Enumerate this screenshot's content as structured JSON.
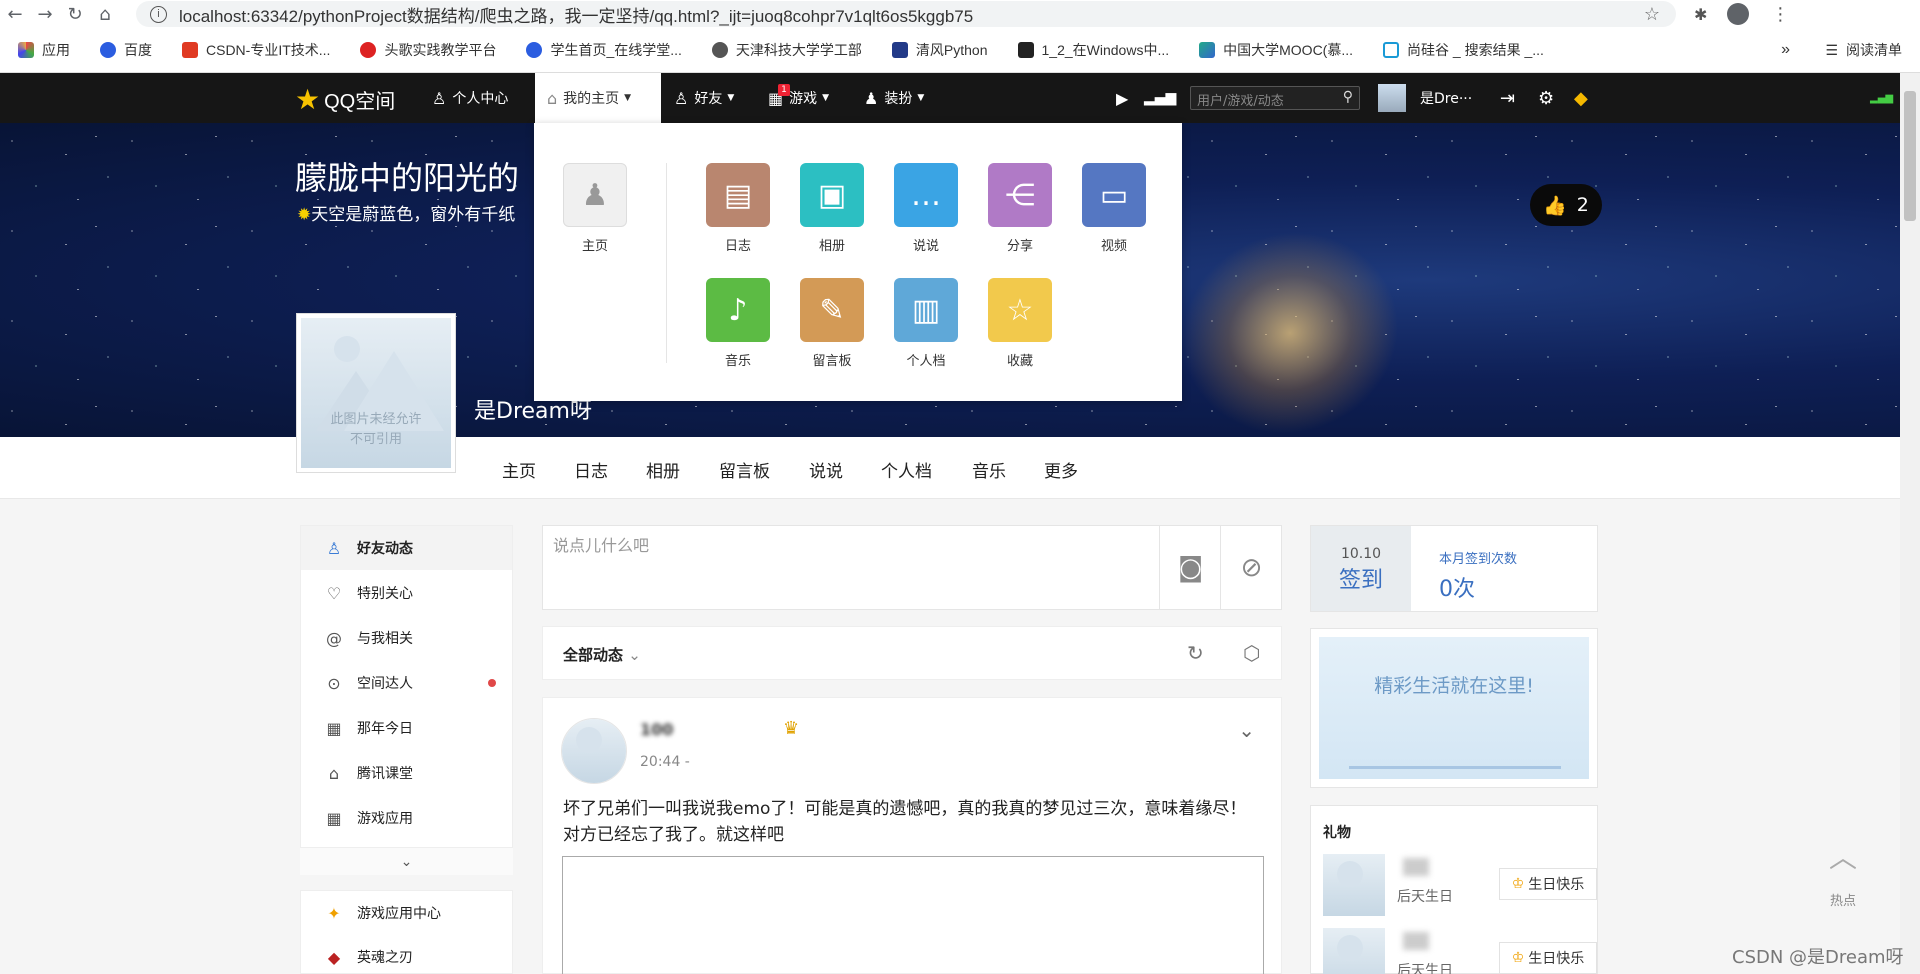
{
  "browser": {
    "url": "localhost:63342/pythonProject数据结构/爬虫之路，我一定坚持/qq.html?_ijt=juoq8cohpr7v1qlt6os5kggb75",
    "bookmarks": [
      "应用",
      "百度",
      "CSDN-专业IT技术...",
      "头歌实践教学平台",
      "学生首页_在线学堂...",
      "天津科技大学学工部",
      "清风Python",
      "1_2_在Windows中...",
      "中国大学MOOC(慕...",
      "尚硅谷 _ 搜索结果 _..."
    ],
    "reading_list": "阅读清单"
  },
  "topbar": {
    "logo": "QQ空间",
    "nav": [
      "个人中心",
      "我的主页",
      "好友",
      "游戏",
      "装扮"
    ],
    "game_badge": "1",
    "search_placeholder": "用户/游戏/动态",
    "user": "是Dre···"
  },
  "banner": {
    "title": "朦胧中的阳光的",
    "subtitle": "天空是蔚蓝色，窗外有千纸",
    "likes": "2",
    "username": "是Dream呀"
  },
  "avatar_text": [
    "此图片未经允许",
    "不可引用"
  ],
  "dropdown": {
    "home": "主页",
    "apps": [
      "日志",
      "相册",
      "说说",
      "分享",
      "视频",
      "音乐",
      "留言板",
      "个人档",
      "收藏"
    ]
  },
  "tabs": [
    "主页",
    "日志",
    "相册",
    "留言板",
    "说说",
    "个人档",
    "音乐",
    "更多"
  ],
  "sidebar": {
    "items": [
      "好友动态",
      "特别关心",
      "与我相关",
      "空间达人",
      "那年今日",
      "腾讯课堂",
      "游戏应用"
    ],
    "items2": [
      "游戏应用中心",
      "英魂之刃"
    ]
  },
  "post_box": {
    "placeholder": "说点儿什么吧"
  },
  "feed": {
    "filter": "全部动态",
    "post": {
      "name": "100",
      "time": "20:44  -",
      "text": "坏了兄弟们一叫我说我emo了！可能是真的遗憾吧，真的我真的梦见过三次，意味着缘尽！对方已经忘了我了。就这样吧"
    }
  },
  "checkin": {
    "date": "10.10",
    "label": "签到",
    "month_label": "本月签到次数",
    "month_value": "0次"
  },
  "promo": "精彩生活就在这里!",
  "gifts": {
    "title": "礼物",
    "items": [
      {
        "when": "后天生日",
        "button": "生日快乐"
      },
      {
        "when": "后天生日",
        "button": "生日快乐"
      }
    ]
  },
  "hot": "热点",
  "watermark": "CSDN @是Dream呀"
}
